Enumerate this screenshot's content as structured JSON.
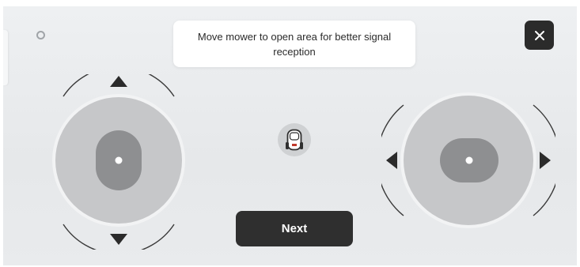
{
  "toast": {
    "message": "Move mower to open area for better signal reception"
  },
  "buttons": {
    "close_icon": "close-icon",
    "next_label": "Next"
  },
  "icons": {
    "status": "status-ring-icon",
    "mower": "robot-mower-icon"
  },
  "joysticks": {
    "left": {
      "axis": "vertical",
      "arrows": [
        "up",
        "down"
      ]
    },
    "right": {
      "axis": "horizontal",
      "arrows": [
        "left",
        "right"
      ]
    }
  },
  "colors": {
    "background": "#e9ebed",
    "toast_background": "#ffffff",
    "button_dark": "#2f2f2f",
    "joystick_base": "#c6c7c9",
    "joystick_knob": "#8e8f91"
  }
}
